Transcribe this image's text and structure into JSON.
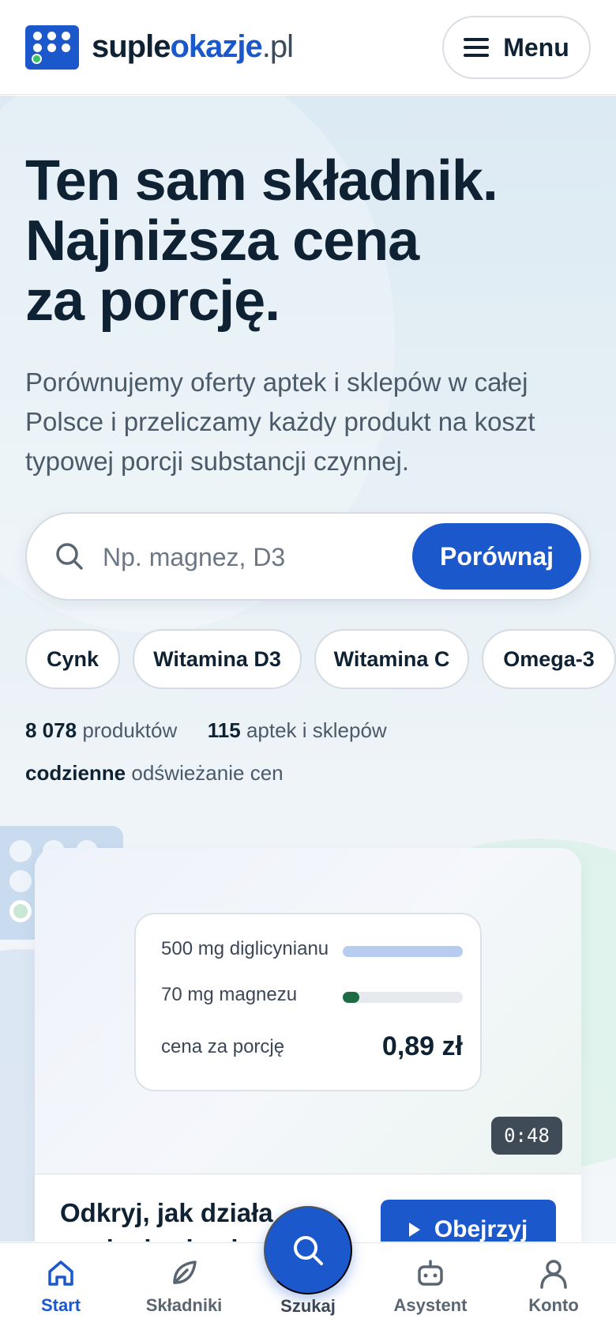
{
  "header": {
    "logo_part1": "suple",
    "logo_part2": "okazje",
    "logo_part3": ".pl",
    "menu_label": "Menu"
  },
  "hero": {
    "headline_line1": "Ten sam składnik.",
    "headline_line2": "Najniższa cena",
    "headline_line3": "za porcję.",
    "subtitle": "Porównujemy oferty aptek i sklepów w całej Polsce i przeliczamy każdy produkt na koszt typowej porcji substancji czynnej."
  },
  "search": {
    "placeholder": "Np. magnez, D3",
    "value": "",
    "button_label": "Porównaj"
  },
  "chips": [
    "Cynk",
    "Witamina D3",
    "Witamina C",
    "Omega-3"
  ],
  "stats": {
    "products_count": "8 078",
    "products_label": "produktów",
    "stores_count": "115",
    "stores_label": "aptek i sklepów",
    "refresh_bold": "codzienne",
    "refresh_label": "odświeżanie cen"
  },
  "video": {
    "row1_label": "500 mg diglicynianu",
    "row2_label": "70 mg magnezu",
    "row3_label": "cena za porcję",
    "price": "0,89 zł",
    "bar1_fraction": 1.0,
    "bar2_fraction": 0.14,
    "bar1_color": "#b7cdf0",
    "bar2_color": "#1d6b45",
    "duration": "0:48",
    "title": "Odkryj, jak działa supleokazje.pl",
    "watch_label": "Obejrzyj"
  },
  "bottom_nav": {
    "start": "Start",
    "ingredients": "Składniki",
    "search": "Szukaj",
    "assistant": "Asystent",
    "account": "Konto"
  },
  "colors": {
    "brand_blue": "#1b58cc",
    "text_dark": "#0f2233",
    "accent_green": "#39c46a"
  },
  "icons": [
    "logo-mark-icon",
    "hamburger-icon",
    "search-icon",
    "play-icon",
    "home-icon",
    "leaf-icon",
    "robot-icon",
    "user-icon"
  ]
}
